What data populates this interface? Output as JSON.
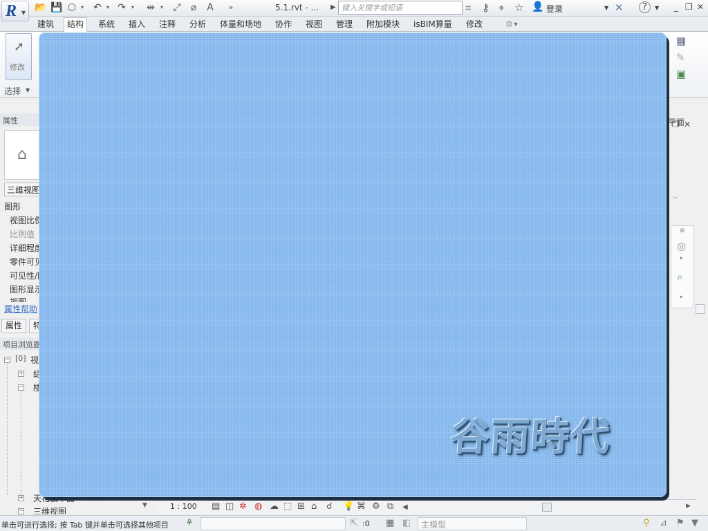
{
  "titlebar": {
    "filename": "5.1.rvt - ...",
    "search_placeholder": "键入关键字或短语",
    "login": "登录"
  },
  "tabs": [
    {
      "label": "建筑",
      "active": false
    },
    {
      "label": "结构",
      "active": true
    },
    {
      "label": "系统",
      "active": false
    },
    {
      "label": "插入",
      "active": false
    },
    {
      "label": "注释",
      "active": false
    },
    {
      "label": "分析",
      "active": false
    },
    {
      "label": "体量和场地",
      "active": false
    },
    {
      "label": "协作",
      "active": false
    },
    {
      "label": "视图",
      "active": false
    },
    {
      "label": "管理",
      "active": false
    },
    {
      "label": "附加模块",
      "active": false
    },
    {
      "label": "isBIM算量",
      "active": false
    },
    {
      "label": "修改",
      "active": false
    }
  ],
  "ribbon": {
    "modify_label": "修改",
    "select_panel": "选择",
    "plane_panel": "平面"
  },
  "properties": {
    "title": "属性",
    "view_type": "三维视图",
    "category": "图形",
    "rows": [
      "视图比例",
      "比例值",
      "详细程度",
      "零件可见性",
      "可见性/图形",
      "图形显示选项",
      "视图"
    ],
    "help_link": "属性帮助",
    "tab_properties": "属性",
    "tab_other": "特"
  },
  "project_browser": {
    "title": "项目浏览器",
    "root": "视图",
    "child1": "结",
    "child2": "楼",
    "bottom1": "天花板平面",
    "bottom2": "三维视图"
  },
  "viewbar": {
    "scale": "1 : 100"
  },
  "statusbar": {
    "message": "单击可进行选择; 按 Tab 键并单击可选择其他项目",
    "zero": ":0",
    "model": "主模型"
  },
  "splash": {
    "brand": "谷雨時代",
    "background_color": "#8dc1f6"
  }
}
